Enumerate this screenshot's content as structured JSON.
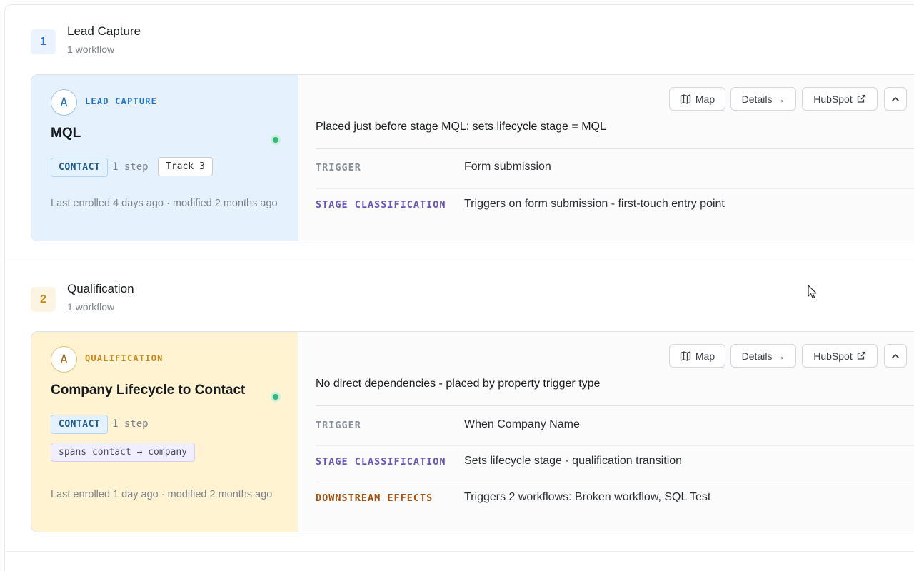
{
  "colors": {
    "blue_accent": "#1f74c9",
    "gold_accent": "#c98a1c",
    "purple_key": "#6a56b5",
    "brown_key": "#a5520f",
    "grey_key": "#8a9098",
    "green_dot": "#35b37e"
  },
  "stages": [
    {
      "number": "1",
      "title": "Lead Capture",
      "subtitle": "1 workflow",
      "workflow": {
        "avatar": "A",
        "category": "LEAD CAPTURE",
        "title": "MQL",
        "object_chip": "CONTACT",
        "steps": "1 step",
        "track_chip": "Track 3",
        "enrolled": "Last enrolled 4 days ago · modified 2 months ago",
        "buttons": {
          "map": "Map",
          "details": "Details →",
          "hubspot": "HubSpot"
        },
        "description": "Placed just before stage MQL: sets lifecycle stage = MQL",
        "rows": [
          {
            "key": "TRIGGER",
            "value": "Form submission"
          },
          {
            "key": "STAGE CLASSIFICATION",
            "value": "Triggers on form submission - first-touch entry point"
          }
        ]
      }
    },
    {
      "number": "2",
      "title": "Qualification",
      "subtitle": "1 workflow",
      "workflow": {
        "avatar": "A",
        "category": "QUALIFICATION",
        "title": "Company Lifecycle to Contact",
        "object_chip": "CONTACT",
        "steps": "1 step",
        "spans_chip": "spans contact → company",
        "enrolled": "Last enrolled 1 day ago · modified 2 months ago",
        "buttons": {
          "map": "Map",
          "details": "Details →",
          "hubspot": "HubSpot"
        },
        "description": "No direct dependencies - placed by property trigger type",
        "rows": [
          {
            "key": "TRIGGER",
            "value": "When Company Name"
          },
          {
            "key": "STAGE CLASSIFICATION",
            "value": "Sets lifecycle stage - qualification transition"
          },
          {
            "key": "DOWNSTREAM EFFECTS",
            "value": "Triggers 2 workflows: Broken workflow, SQL Test"
          }
        ]
      }
    }
  ]
}
